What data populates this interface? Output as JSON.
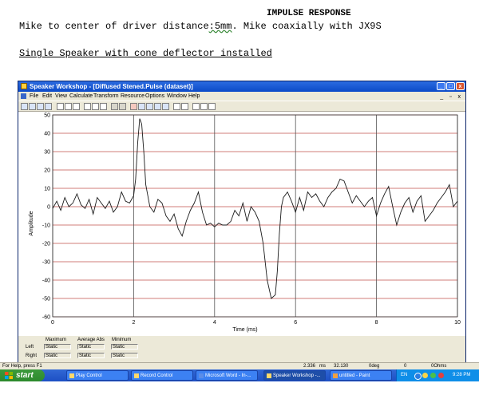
{
  "document": {
    "heading": "IMPULSE RESPONSE",
    "line1_prefix": "Mike to center of driver distance",
    "line1_squiggle": ":5mm",
    "line1_suffix": ". Mike coaxially with JX9S",
    "line2": "Single Speaker with cone deflector installed"
  },
  "window": {
    "title": "Speaker Workshop - [Diffused Stened.Pulse (dataset)]",
    "menu": [
      "File",
      "Edit",
      "View",
      "Calculate",
      "Transform",
      "Resource",
      "Options",
      "Window",
      "Help"
    ]
  },
  "toolbar": {
    "icons": [
      "select-icon",
      "dataset-icon",
      "chart-icon",
      "grid-icon",
      "new-icon",
      "open-icon",
      "save-icon",
      "cut-icon",
      "copy-icon",
      "paste-icon",
      "undo-icon",
      "redo-icon",
      "measure-icon",
      "chart-view-icon",
      "table-view-icon",
      "props-icon",
      "calc-icon",
      "zoom-in-icon",
      "zoom-out-icon",
      "print-icon",
      "help-icon",
      "context-help-icon"
    ]
  },
  "chart_data": {
    "type": "line",
    "xlabel": "Time (ms)",
    "ylabel": "Amplitude",
    "xlim": [
      0,
      10
    ],
    "ylim": [
      -60,
      50
    ],
    "x_ticks": [
      "0",
      "2",
      "4",
      "6",
      "8",
      "10"
    ],
    "y_ticks": [
      "50",
      "40",
      "30",
      "20",
      "10",
      "0",
      "-10",
      "-20",
      "-30",
      "-40",
      "-50",
      "-60"
    ],
    "grid": true,
    "series": [
      {
        "color": "#1a1a1a",
        "x": [
          0,
          0.1,
          0.2,
          0.3,
          0.4,
          0.5,
          0.6,
          0.7,
          0.8,
          0.9,
          1.0,
          1.1,
          1.2,
          1.3,
          1.4,
          1.5,
          1.6,
          1.7,
          1.8,
          1.9,
          2.0,
          2.05,
          2.1,
          2.15,
          2.2,
          2.25,
          2.3,
          2.4,
          2.5,
          2.6,
          2.7,
          2.8,
          2.9,
          3.0,
          3.1,
          3.2,
          3.3,
          3.4,
          3.5,
          3.6,
          3.7,
          3.8,
          3.9,
          4.0,
          4.1,
          4.2,
          4.3,
          4.4,
          4.5,
          4.6,
          4.7,
          4.8,
          4.9,
          5.0,
          5.1,
          5.2,
          5.3,
          5.4,
          5.5,
          5.55,
          5.6,
          5.65,
          5.7,
          5.8,
          5.9,
          6.0,
          6.1,
          6.2,
          6.3,
          6.4,
          6.5,
          6.6,
          6.7,
          6.8,
          6.9,
          7.0,
          7.1,
          7.2,
          7.3,
          7.4,
          7.5,
          7.6,
          7.7,
          7.8,
          7.9,
          8.0,
          8.1,
          8.2,
          8.3,
          8.4,
          8.5,
          8.6,
          8.7,
          8.8,
          8.9,
          9.0,
          9.1,
          9.2,
          9.3,
          9.4,
          9.5,
          9.6,
          9.7,
          9.8,
          9.9,
          10.0
        ],
        "y": [
          -1,
          3,
          -2,
          5,
          0,
          2,
          7,
          1,
          -1,
          4,
          -4,
          5,
          2,
          -1,
          3,
          -3,
          0,
          8,
          3,
          2,
          6,
          15,
          35,
          48,
          45,
          30,
          12,
          0,
          -3,
          4,
          2,
          -5,
          -8,
          -4,
          -12,
          -16,
          -8,
          -2,
          2,
          8,
          -3,
          -10,
          -9,
          -11,
          -9,
          -10,
          -10,
          -8,
          -2,
          -5,
          2,
          -8,
          0,
          -3,
          -8,
          -20,
          -40,
          -50,
          -48,
          -35,
          -15,
          0,
          5,
          8,
          3,
          -3,
          5,
          -2,
          8,
          5,
          7,
          3,
          0,
          5,
          8,
          10,
          15,
          14,
          8,
          2,
          6,
          3,
          0,
          3,
          5,
          -5,
          2,
          7,
          11,
          0,
          -10,
          -3,
          2,
          5,
          -3,
          3,
          6,
          -8,
          -5,
          -2,
          2,
          5,
          8,
          12,
          0,
          3
        ]
      }
    ]
  },
  "stats": {
    "headers": [
      "Maximum",
      "Average Abs",
      "Minimum"
    ],
    "rows": [
      {
        "label": "Left",
        "values": [
          "Static",
          "Static",
          "Static"
        ]
      },
      {
        "label": "Right",
        "values": [
          "Static",
          "Static",
          "Static"
        ]
      }
    ]
  },
  "statusbar": {
    "help": "For Help, press F1",
    "time": "2.336",
    "time_unit": "ms",
    "value": "32.130",
    "angle": "0deg",
    "zero": "0",
    "ohms": "0Ohms"
  },
  "taskbar": {
    "start": "start",
    "tasks": [
      {
        "label": "Play Control",
        "active": false
      },
      {
        "label": "Record Control",
        "active": false
      },
      {
        "label": "Microsoft Word - In-...",
        "active": false
      },
      {
        "label": "Speaker Workshop -...",
        "active": true
      },
      {
        "label": "untitled - Paint",
        "active": false
      }
    ],
    "lang": "EN",
    "clock": "9:28 PM"
  }
}
